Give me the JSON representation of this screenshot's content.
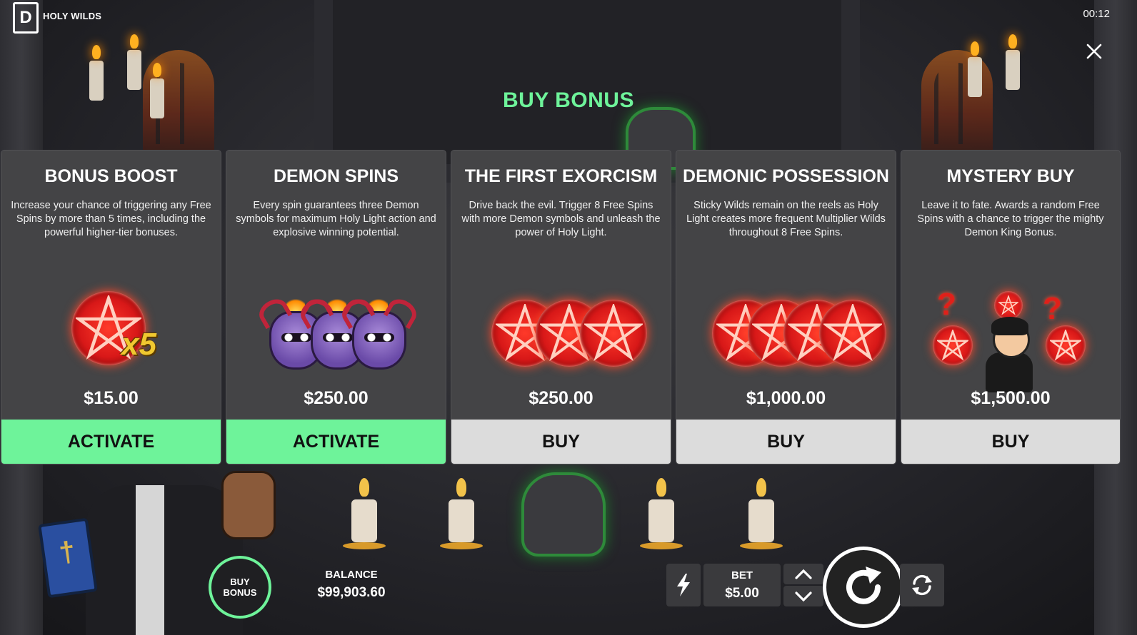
{
  "game": {
    "title": "HOLY WILDS",
    "logo_letter": "D",
    "clock": "00:12"
  },
  "modal": {
    "heading": "BUY BONUS",
    "close_icon": "close-icon",
    "accent_color": "#6ef39a",
    "cards": [
      {
        "title": "BONUS BOOST",
        "description": "Increase your chance of triggering any Free Spins by more than 5 times, including the powerful higher-tier bonuses.",
        "price": "$15.00",
        "action": "ACTIVATE",
        "art_multiplier": "x5",
        "art": "pentagram-x5-icon"
      },
      {
        "title": "DEMON SPINS",
        "description": "Every spin guarantees three Demon symbols for maximum Holy Light action and explosive winning potential.",
        "price": "$250.00",
        "action": "ACTIVATE",
        "art": "three-demon-skulls-icon"
      },
      {
        "title": "THE FIRST EXORCISM",
        "description": "Drive back the evil. Trigger 8 Free Spins with more Demon symbols and unleash the power of Holy Light.",
        "price": "$250.00",
        "action": "BUY",
        "art": "three-pentagrams-icon"
      },
      {
        "title": "DEMONIC POSSESSION",
        "description": "Sticky Wilds remain on the reels as Holy Light creates more frequent Multiplier Wilds throughout 8 Free Spins.",
        "price": "$1,000.00",
        "action": "BUY",
        "art": "four-pentagrams-icon"
      },
      {
        "title": "MYSTERY BUY",
        "description": "Leave it to fate. Awards a random Free Spins with a chance to trigger the mighty Demon King Bonus.",
        "price": "$1,500.00",
        "action": "BUY",
        "art": "mystery-priest-icon"
      }
    ]
  },
  "bottom": {
    "buy_bonus_line1": "BUY",
    "buy_bonus_line2": "BONUS",
    "balance_label": "BALANCE",
    "balance_value": "$99,903.60",
    "bet_label": "BET",
    "bet_value": "$5.00",
    "icons": [
      "turbo-icon",
      "bet-up-icon",
      "bet-down-icon",
      "spin-icon",
      "autoplay-icon"
    ]
  }
}
